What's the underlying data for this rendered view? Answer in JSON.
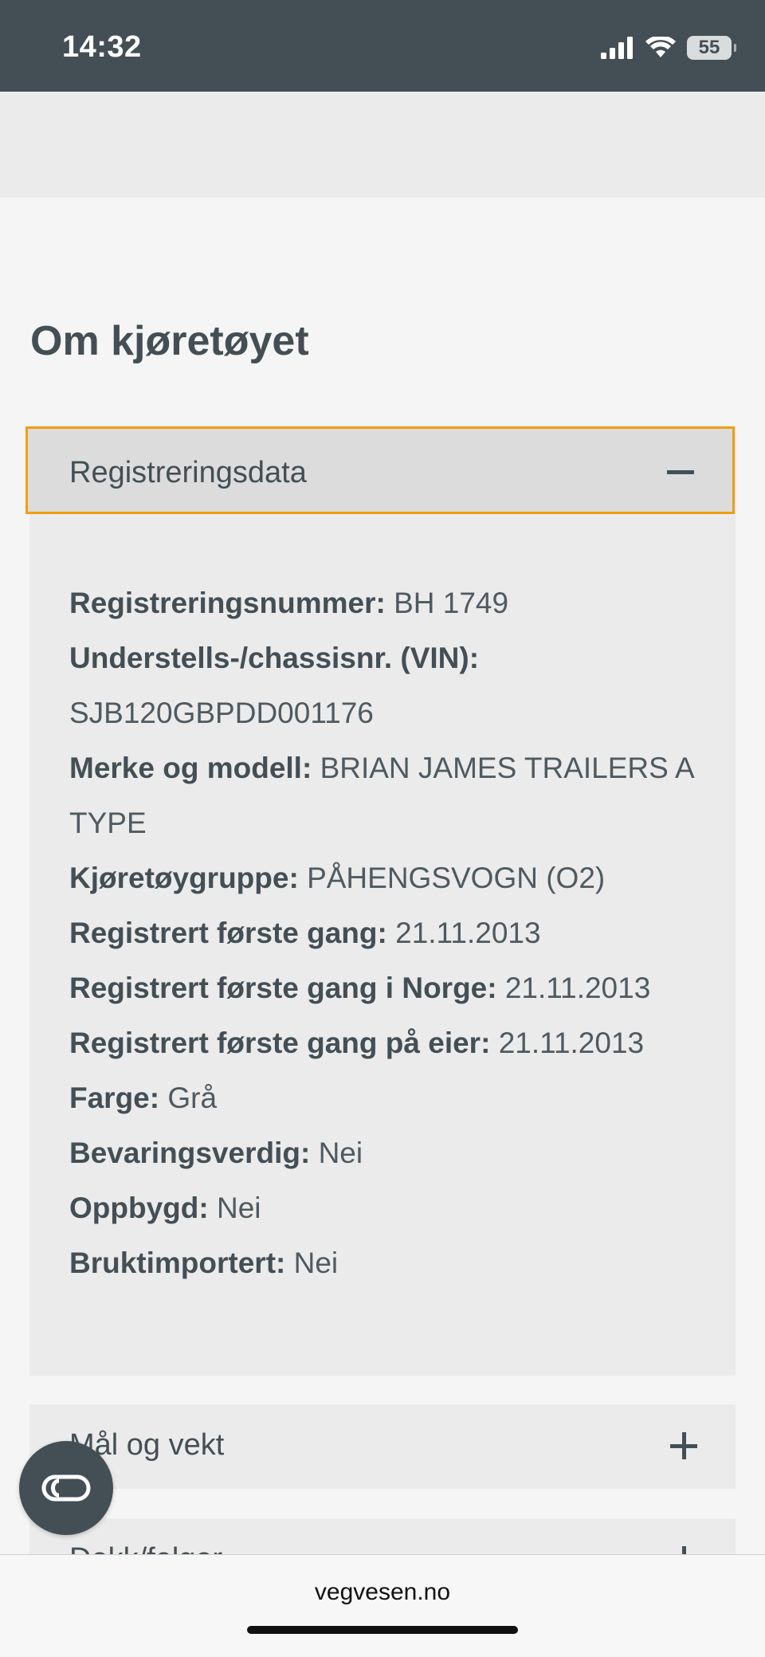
{
  "status_bar": {
    "time": "14:32",
    "battery": "55",
    "icons": [
      "signal-icon",
      "wifi-icon",
      "battery-icon"
    ]
  },
  "page": {
    "title": "Om kjøretøyet"
  },
  "registreringsdata": {
    "title": "Registreringsdata",
    "expanded": true,
    "rows": [
      {
        "label": "Registreringsnummer:",
        "value": "BH 1749"
      },
      {
        "label": "Understells-/chassisnr. (VIN):",
        "value": "SJB120GBPDD001176"
      },
      {
        "label": "Merke og modell:",
        "value": "BRIAN JAMES TRAILERS A TYPE"
      },
      {
        "label": "Kjøretøygruppe:",
        "value": "PÅHENGSVOGN (O2)"
      },
      {
        "label": "Registrert første gang:",
        "value": "21.11.2013"
      },
      {
        "label": "Registrert første gang i Norge:",
        "value": "21.11.2013"
      },
      {
        "label": "Registrert første gang på eier:",
        "value": "21.11.2013"
      },
      {
        "label": "Farge:",
        "value": "Grå"
      },
      {
        "label": "Bevaringsverdig:",
        "value": "Nei"
      },
      {
        "label": "Oppbygd:",
        "value": "Nei"
      },
      {
        "label": "Bruktimportert:",
        "value": "Nei"
      }
    ]
  },
  "sections": [
    {
      "title": "Mål og vekt"
    },
    {
      "title": "Dekk/felger"
    }
  ],
  "browser": {
    "url": "vegvesen.no"
  },
  "colors": {
    "primary": "#444f55",
    "focus_outline": "#f39c12",
    "panel": "#ebebeb",
    "header_bg": "#dcdcdc"
  }
}
